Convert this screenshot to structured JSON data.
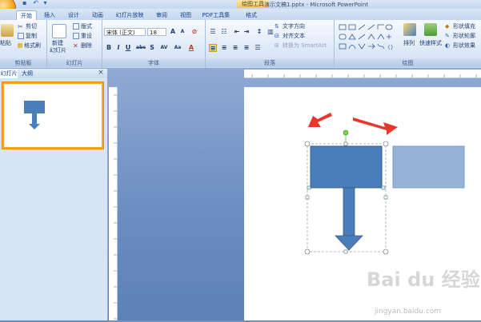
{
  "window": {
    "title": "演示文稿1.pptx - Microsoft PowerPoint",
    "contextual_tab": "绘图工具"
  },
  "tabs": [
    {
      "label": "开始",
      "active": true
    },
    {
      "label": "插入"
    },
    {
      "label": "设计"
    },
    {
      "label": "动画"
    },
    {
      "label": "幻灯片放映"
    },
    {
      "label": "审阅"
    },
    {
      "label": "视图"
    },
    {
      "label": "PDF工具集"
    },
    {
      "label": "格式"
    }
  ],
  "ribbon": {
    "clipboard": {
      "label": "剪贴板",
      "paste": "粘贴",
      "cut": "剪切",
      "copy": "复制",
      "format_painter": "格式刷"
    },
    "slides": {
      "label": "幻灯片",
      "new_slide": "新建",
      "new_slide_2": "幻灯片",
      "layout": "版式",
      "reset": "重设",
      "delete": "删除"
    },
    "font": {
      "label": "字体",
      "font_name": "宋体 (正文)",
      "font_size": "18",
      "bold": "B",
      "italic": "I",
      "underline": "U",
      "strike": "abc",
      "shadow": "S",
      "spacing": "AV",
      "case": "Aa",
      "color": "A",
      "grow": "A",
      "shrink": "A"
    },
    "paragraph": {
      "label": "段落",
      "text_direction": "文字方向",
      "align_text": "对齐文本",
      "smartart": "转换为 SmartArt"
    },
    "drawing": {
      "label": "绘图",
      "arrange": "排列",
      "quick_styles": "快速样式",
      "shape_fill": "形状填充",
      "shape_outline": "形状轮廓",
      "shape_effects": "形状效果"
    }
  },
  "pane": {
    "tab_slides": "幻灯片",
    "tab_outline": "大纲",
    "close": "×"
  },
  "colors": {
    "shape_fill": "#4a7ebb",
    "shape_light": "#95b3d7",
    "annotation_arrow": "#e8372b",
    "thumb_border": "#f5a623"
  },
  "watermark": {
    "text": "Bai du 经验",
    "sub": "jingyan.baidu.com"
  }
}
